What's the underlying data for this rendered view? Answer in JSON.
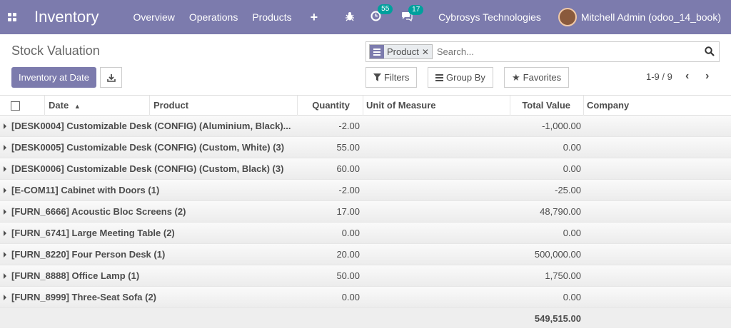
{
  "navbar": {
    "brand": "Inventory",
    "menu": [
      "Overview",
      "Operations",
      "Products"
    ],
    "activity_count": "55",
    "message_count": "17",
    "company": "Cybrosys Technologies",
    "user": "Mitchell Admin (odoo_14_book)",
    "accent": "#7c7bad"
  },
  "control": {
    "title": "Stock Valuation",
    "primary_button": "Inventory at Date",
    "facet_label": "Product",
    "search_placeholder": "Search...",
    "filters": "Filters",
    "group_by": "Group By",
    "favorites": "Favorites",
    "pager": "1-9 / 9"
  },
  "table": {
    "headers": {
      "date": "Date",
      "product": "Product",
      "quantity": "Quantity",
      "uom": "Unit of Measure",
      "total_value": "Total Value",
      "company": "Company"
    },
    "groups": [
      {
        "name": "[DESK0004] Customizable Desk (CONFIG) (Aluminium, Black)...",
        "quantity": "-2.00",
        "value": "-1,000.00"
      },
      {
        "name": "[DESK0005] Customizable Desk (CONFIG) (Custom, White) (3)",
        "quantity": "55.00",
        "value": "0.00"
      },
      {
        "name": "[DESK0006] Customizable Desk (CONFIG) (Custom, Black) (3)",
        "quantity": "60.00",
        "value": "0.00"
      },
      {
        "name": "[E-COM11] Cabinet with Doors (1)",
        "quantity": "-2.00",
        "value": "-25.00"
      },
      {
        "name": "[FURN_6666] Acoustic Bloc Screens (2)",
        "quantity": "17.00",
        "value": "48,790.00"
      },
      {
        "name": "[FURN_6741] Large Meeting Table (2)",
        "quantity": "0.00",
        "value": "0.00"
      },
      {
        "name": "[FURN_8220] Four Person Desk (1)",
        "quantity": "20.00",
        "value": "500,000.00"
      },
      {
        "name": "[FURN_8888] Office Lamp (1)",
        "quantity": "50.00",
        "value": "1,750.00"
      },
      {
        "name": "[FURN_8999] Three-Seat Sofa (2)",
        "quantity": "0.00",
        "value": "0.00"
      }
    ],
    "total_value": "549,515.00"
  }
}
